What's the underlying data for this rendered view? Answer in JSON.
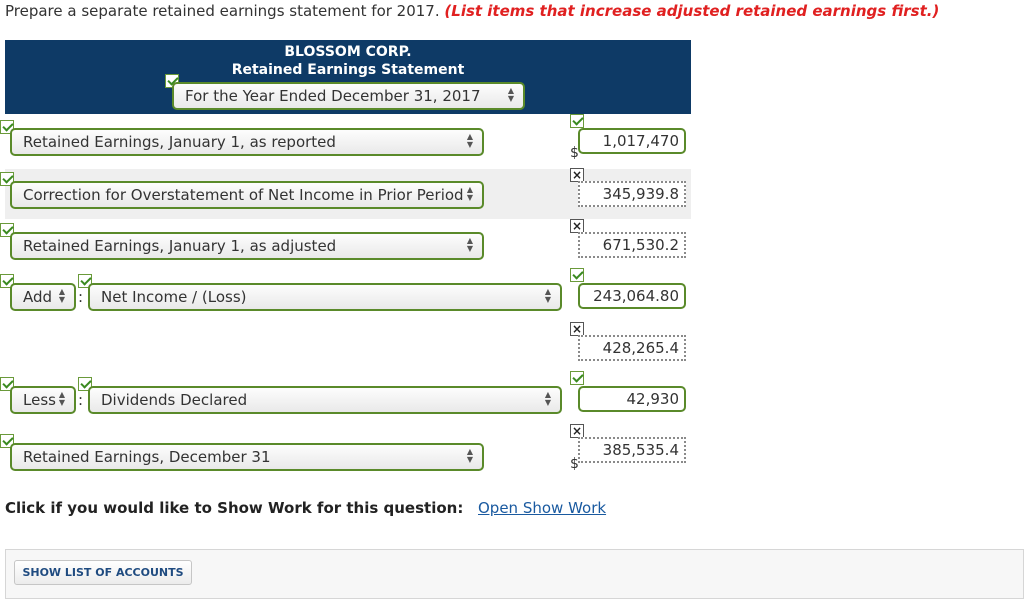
{
  "instructions": {
    "prefix": "Prepare a separate retained earnings statement for 2017.",
    "emphasis": "(List items that increase adjusted retained earnings first.)"
  },
  "statement": {
    "company": "BLOSSOM CORP.",
    "title": "Retained Earnings Statement",
    "period": "For the Year Ended December 31, 2017"
  },
  "rows": [
    {
      "label": "Retained Earnings, January 1, as reported",
      "value": "1,017,470",
      "currency": "$",
      "status": "correct"
    },
    {
      "label": "Correction for Overstatement of Net Income in Prior Period",
      "value": "345,939.8",
      "status": "incorrect"
    },
    {
      "label": "Retained Earnings, January 1, as adjusted",
      "value": "671,530.2",
      "status": "incorrect"
    },
    {
      "operator": "Add",
      "label": "Net Income / (Loss)",
      "value": "243,064.80",
      "status": "correct"
    },
    {
      "value": "428,265.4",
      "status": "incorrect"
    },
    {
      "operator": "Less",
      "label": "Dividends Declared",
      "value": "42,930",
      "status": "correct"
    },
    {
      "label": "Retained Earnings, December 31",
      "value": "385,535.4",
      "currency": "$",
      "status": "incorrect"
    }
  ],
  "show_work": {
    "label": "Click if you would like to Show Work for this question:",
    "link": "Open Show Work"
  },
  "accounts_button": "SHOW LIST OF ACCOUNTS",
  "colors": {
    "header_bg": "#0e3a66",
    "correct_border": "#5a8a2a",
    "emphasis_text": "#e02020",
    "link": "#1a5aa0"
  },
  "icons": [
    "check-icon",
    "x-mark-icon",
    "select-arrows-icon"
  ]
}
